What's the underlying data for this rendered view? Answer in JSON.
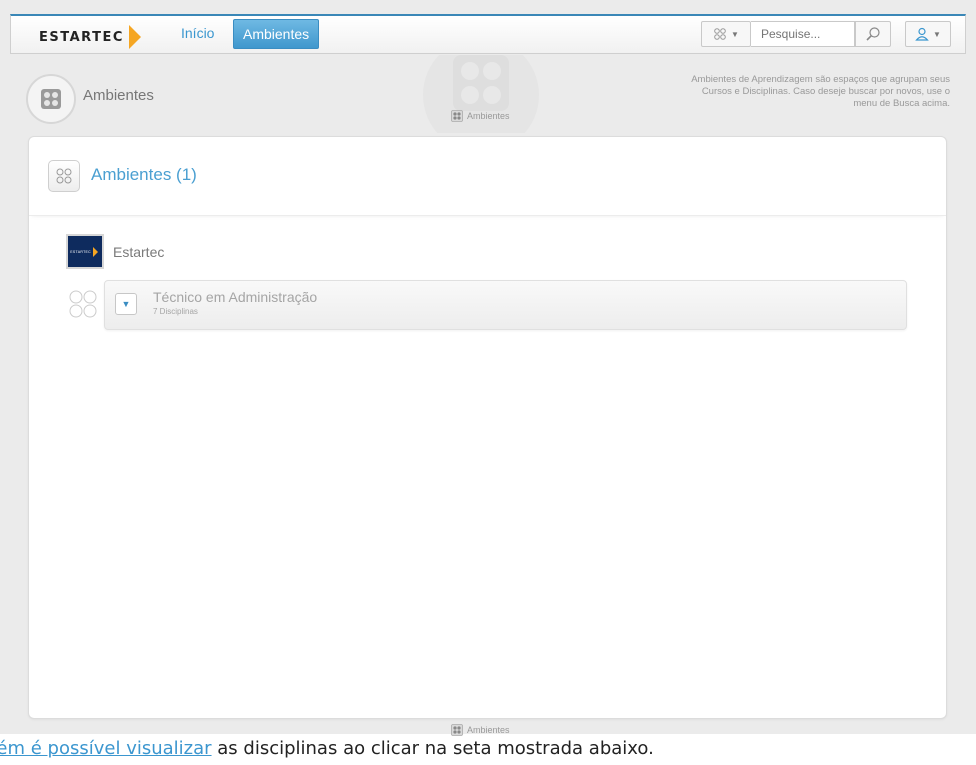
{
  "topbar": {
    "logo_text": "ESTARTEC",
    "nav": {
      "inicio": "Início",
      "ambientes": "Ambientes"
    },
    "search_placeholder": "Pesquise..."
  },
  "page": {
    "title": "Ambientes",
    "breadcrumb": "Ambientes",
    "help": "Ambientes de Aprendizagem são espaços que agrupam seus Cursos e Disciplinas. Caso deseje buscar por novos, use o menu de Busca acima."
  },
  "panel": {
    "title": "Ambientes (1)",
    "organization": {
      "name": "Estartec",
      "logo_text": "ESTARTEC"
    },
    "course": {
      "name": "Técnico em Administração",
      "subtitle": "7 Disciplinas"
    }
  },
  "footer": {
    "breadcrumb": "Ambientes"
  },
  "document": {
    "link_text": "bém é possível visualizar",
    "rest_text": " as disciplinas ao clicar na seta mostrada abaixo."
  },
  "colors": {
    "accent": "#3b97cf",
    "brand_orange": "#f5a623",
    "logo_navy": "#0e2b5e"
  }
}
